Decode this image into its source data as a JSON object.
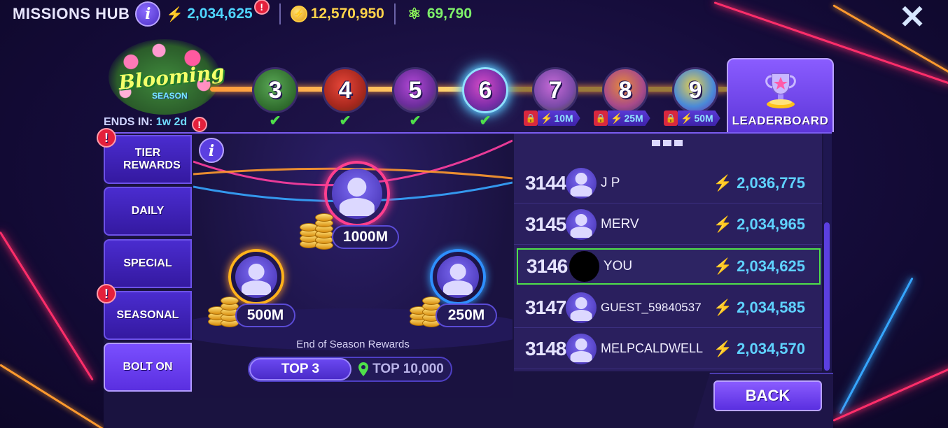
{
  "header": {
    "title": "MISSIONS HUB",
    "bolts": "2,034,625",
    "coins": "12,570,950",
    "gems": "69,790",
    "alert": "!"
  },
  "season": {
    "logo_title": "Blooming",
    "logo_sub": "SEASON",
    "ends_in_label": "ENDS IN:",
    "ends_in_value": "1w 2d",
    "alert": "!",
    "tiers": [
      {
        "number": "3",
        "completed": true,
        "locked": false,
        "requirement": ""
      },
      {
        "number": "4",
        "completed": true,
        "locked": false,
        "requirement": ""
      },
      {
        "number": "5",
        "completed": true,
        "locked": false,
        "requirement": ""
      },
      {
        "number": "6",
        "completed": true,
        "locked": false,
        "current": true,
        "requirement": ""
      },
      {
        "number": "7",
        "completed": false,
        "locked": true,
        "requirement": "10M"
      },
      {
        "number": "8",
        "completed": false,
        "locked": true,
        "requirement": "25M"
      },
      {
        "number": "9",
        "completed": false,
        "locked": true,
        "requirement": "50M"
      }
    ]
  },
  "leaderboard_tab": {
    "label": "LEADERBOARD"
  },
  "side_tabs": [
    {
      "label": "TIER REWARDS",
      "alert": true
    },
    {
      "label": "DAILY",
      "alert": false
    },
    {
      "label": "SPECIAL",
      "alert": false
    },
    {
      "label": "SEASONAL",
      "alert": true
    },
    {
      "label": "BOLT ON",
      "alert": false,
      "active": true
    }
  ],
  "rewards": {
    "first_prize": "1000M",
    "second_prize": "500M",
    "third_prize": "250M",
    "caption": "End of Season Rewards",
    "toggle_selected": "TOP 3",
    "toggle_other": "TOP 10,000"
  },
  "leaderboard": {
    "rows": [
      {
        "rank": "3144",
        "name": "J P",
        "score": "2,036,775",
        "you": false
      },
      {
        "rank": "3145",
        "name": "MERV",
        "score": "2,034,965",
        "you": false
      },
      {
        "rank": "3146",
        "name": "YOU",
        "score": "2,034,625",
        "you": true
      },
      {
        "rank": "3147",
        "name": "GUEST_59840537",
        "score": "2,034,585",
        "you": false
      },
      {
        "rank": "3148",
        "name": "MELPCALDWELL",
        "score": "2,034,570",
        "you": false
      }
    ],
    "back_label": "BACK"
  },
  "colors": {
    "accent_purple": "#6a48f0",
    "score_cyan": "#5fd2ff",
    "bolt_yellow": "#ffc21a",
    "you_highlight": "#4fe04a",
    "alert_red": "#e4203c"
  }
}
